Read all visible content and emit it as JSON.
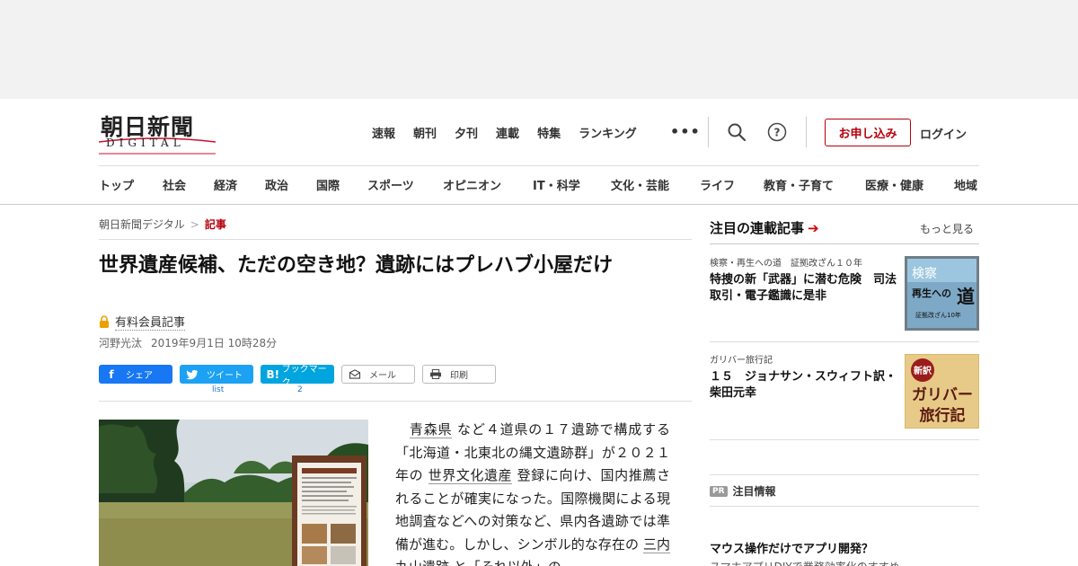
{
  "logo": {
    "kanji": "朝日新聞",
    "digital": "DIGITAL"
  },
  "topnav": [
    "速報",
    "朝刊",
    "夕刊",
    "連載",
    "特集",
    "ランキング"
  ],
  "header_actions": {
    "more": "•••",
    "apply": "お申し込み",
    "login": "ログイン",
    "search_icon": "search-icon",
    "help_icon": "help-icon"
  },
  "catnav": [
    "トップ",
    "社会",
    "経済",
    "政治",
    "国際",
    "スポーツ",
    "オピニオン",
    "IT・科学",
    "文化・芸能",
    "ライフ",
    "教育・子育て",
    "医療・健康",
    "地域"
  ],
  "breadcrumb": {
    "home": "朝日新聞デジタル",
    "sep": ">",
    "current": "記事"
  },
  "article": {
    "headline": "世界遺産候補、ただの空き地？遺跡にはプレハブ小屋だけ",
    "paid_label": "有料会員記事",
    "author": "河野光汰",
    "date": "2019年9月1日 10時28分",
    "body": {
      "p1": "　",
      "l1": "青森県",
      "p2": " など４道県の１７遺跡で構成する「北海道・北東北の縄文遺跡群」が２０２１年の ",
      "l2": "世界文化遺産",
      "p3": " 登録に向け、国内推薦されることが確実になった。国際機関による現地調査などへの対策など、県内各遺跡では準備が進む。しかし、シンボル的な存在の ",
      "l3": "三内丸山遺跡",
      "p4": " と「それ以外」の"
    }
  },
  "share": {
    "facebook": "シェア",
    "twitter": "ツイート",
    "twitter_count": "list",
    "hatena": "ブックマーク",
    "hatena_count": "2",
    "mail": "メール",
    "print": "印刷"
  },
  "sidebar": {
    "title": "注目の連載記事",
    "arrow": "➔",
    "more": "もっと見る",
    "items": [
      {
        "series": "検察・再生への道　証拠改ざん１０年",
        "title": "特捜の新「武器」に潜む危険　司法取引・電子鑑識に是非",
        "thumb": {
          "l1": "検察",
          "l2": "再生への",
          "l3": "道",
          "l4": "証拠改ざん10年"
        }
      },
      {
        "series": "ガリバー旅行記",
        "title": "１５　ジョナサン・スウィフト訳・柴田元幸",
        "thumb": {
          "stamp": "新訳",
          "l1": "ガリバー",
          "l2": "旅行記"
        }
      }
    ],
    "pr_tag": "PR",
    "pr_title": "注目情報",
    "promo_title": "マウス操作だけでアプリ開発？",
    "promo_sub": "スマホアプリDIYで業務効率化のすすめ"
  },
  "colors": {
    "brand_red": "#b5000c",
    "facebook": "#1877f2",
    "twitter": "#1da1f2",
    "hatena": "#00a4de"
  }
}
